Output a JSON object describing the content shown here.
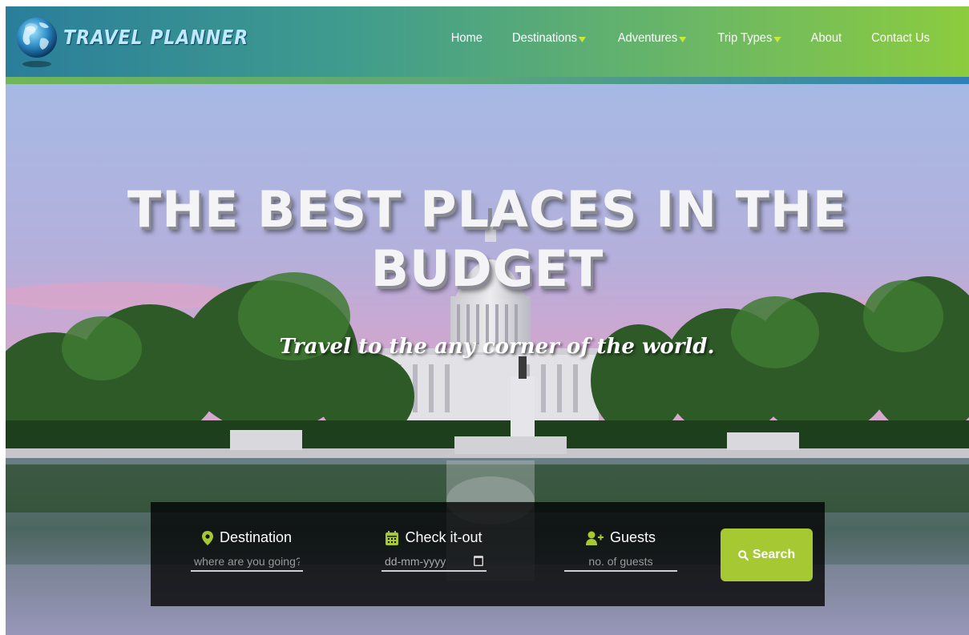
{
  "brand": {
    "name": "TRAVEL PLANNER"
  },
  "nav": {
    "items": [
      {
        "label": "Home",
        "dropdown": false
      },
      {
        "label": "Destinations",
        "dropdown": true
      },
      {
        "label": "Adventures",
        "dropdown": true
      },
      {
        "label": "Trip Types",
        "dropdown": true
      },
      {
        "label": "About",
        "dropdown": false
      },
      {
        "label": "Contact Us",
        "dropdown": false
      }
    ]
  },
  "hero": {
    "headline_line1": "THE BEST PLACES IN THE",
    "headline_line2": "BUDGET",
    "subheadline": "Travel to the any corner of the world."
  },
  "search": {
    "destination_label": "Destination",
    "destination_placeholder": "where are you going?",
    "checkout_label": "Check it-out",
    "checkout_placeholder": "dd-mm-yyyy",
    "guests_label": "Guests",
    "guests_placeholder": "no. of guests",
    "button_label": "Search"
  },
  "colors": {
    "accent": "#a6c933",
    "caret": "#c8e83a",
    "nav_start": "#2a7e9a",
    "nav_end": "#8ccc3e"
  },
  "icons": {
    "logo": "globe-icon",
    "destination": "map-pin-icon",
    "checkout": "calendar-icon",
    "guests": "user-plus-icon",
    "search": "search-icon"
  }
}
